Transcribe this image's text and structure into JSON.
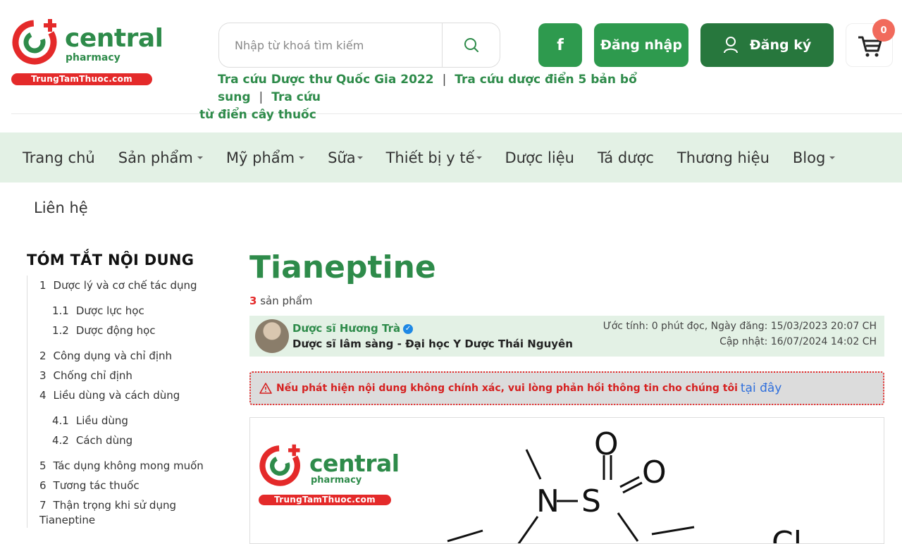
{
  "brand": {
    "name": "central",
    "sub": "pharmacy",
    "band": "TrungTamThuoc.com"
  },
  "search": {
    "placeholder": "Nhập từ khoá tìm kiếm"
  },
  "header_buttons": {
    "facebook": "f",
    "login": "Đăng nhập",
    "register": "Đăng ký",
    "cart_count": "0"
  },
  "quick_links": [
    "Tra cứu Dược thư Quốc Gia 2022",
    "Tra cứu dược điển 5 bản bổ sung",
    "Tra cứu",
    "từ điển cây thuốc"
  ],
  "separator": "|",
  "nav": {
    "items": [
      {
        "label": "Trang chủ"
      },
      {
        "label": "Sản phẩm"
      },
      {
        "label": "Mỹ phẩm"
      },
      {
        "label": "Sữa"
      },
      {
        "label": "Thiết bị y tế"
      },
      {
        "label": "Dược liệu"
      },
      {
        "label": "Tá dược"
      },
      {
        "label": "Thương hiệu"
      },
      {
        "label": "Blog"
      }
    ],
    "second_row": "Liên hệ"
  },
  "toc": {
    "title": "TÓM TẮT NỘI DUNG",
    "items": [
      {
        "num": "1",
        "label": "Dược lý và cơ chế tác dụng"
      },
      {
        "num": "1.1",
        "label": "Dược lực học"
      },
      {
        "num": "1.2",
        "label": "Dược động học"
      },
      {
        "num": "2",
        "label": "Công dụng và chỉ định"
      },
      {
        "num": "3",
        "label": "Chống chỉ định"
      },
      {
        "num": "4",
        "label": "Liều dùng và cách dùng"
      },
      {
        "num": "4.1",
        "label": "Liều dùng"
      },
      {
        "num": "4.2",
        "label": "Cách dùng"
      },
      {
        "num": "5",
        "label": "Tác dụng không mong muốn"
      },
      {
        "num": "6",
        "label": "Tương tác thuốc"
      },
      {
        "num": "7",
        "label": "Thận trọng khi sử dụng Tianeptine"
      }
    ]
  },
  "article": {
    "title": "Tianeptine",
    "product_count": "3",
    "product_label": "sản phẩm",
    "author_name": "Dược sĩ Hương Trà",
    "author_role": "Dược sĩ lâm sàng - Đại học Y Dược Thái Nguyên",
    "meta_estimate": "Ước tính: 0 phút đọc, Ngày đăng: 15/03/2023 20:07 CH",
    "meta_updated": "Cập nhật: 16/07/2024 14:02 CH",
    "warning_text": "Nếu phát hiện nội dung không chính xác, vui lòng phản hồi thông tin cho chúng tôi",
    "warning_link": "tại đây"
  },
  "molecule_labels": {
    "n": "N",
    "s": "S",
    "o1": "O",
    "o2": "O",
    "cl": "Cl"
  },
  "colors": {
    "brand_green": "#2e8b4a",
    "dark_green": "#27773d",
    "nav_bg": "#e3f1e5",
    "brand_red": "#e42a2a"
  }
}
